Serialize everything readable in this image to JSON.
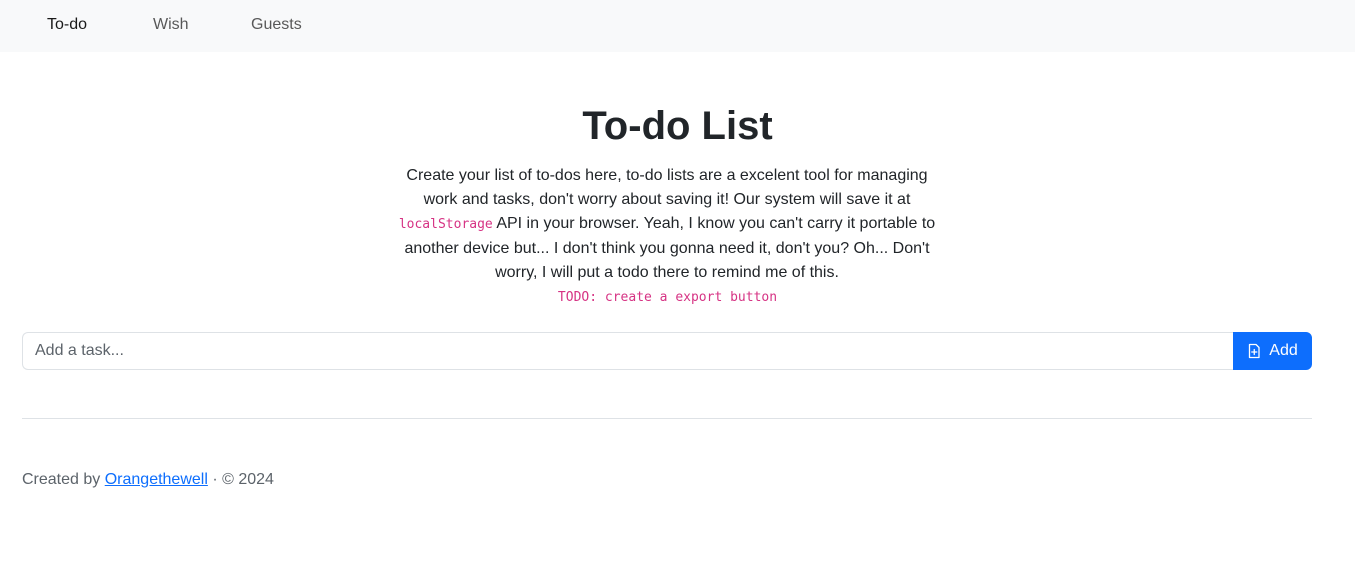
{
  "nav": {
    "items": [
      {
        "label": "To-do",
        "active": true
      },
      {
        "label": "Wish",
        "active": false
      },
      {
        "label": "Guests",
        "active": false
      }
    ]
  },
  "page": {
    "title": "To-do List",
    "description": {
      "part1": "Create your list of to-dos here, to-do lists are a excelent tool for managing work and tasks, don't worry about saving it! Our system will save it at",
      "code": "localStorage",
      "part2": "API in your browser. Yeah, I know you can't carry it portable to another device but... I don't think you gonna need it, don't you? Oh... Don't worry, I will put a todo there to remind me of this."
    },
    "todo_note": "TODO: create a export button"
  },
  "task_form": {
    "placeholder": "Add a task...",
    "value": "",
    "add_label": "Add",
    "add_icon": "file-plus-icon"
  },
  "footer": {
    "prefix": "Created by",
    "author": "Orangethewell",
    "suffix": "· © 2024"
  },
  "colors": {
    "navbar_bg": "#f8f9fa",
    "primary": "#0d6efd",
    "code": "#d63384",
    "divider": "#dee2e6"
  }
}
